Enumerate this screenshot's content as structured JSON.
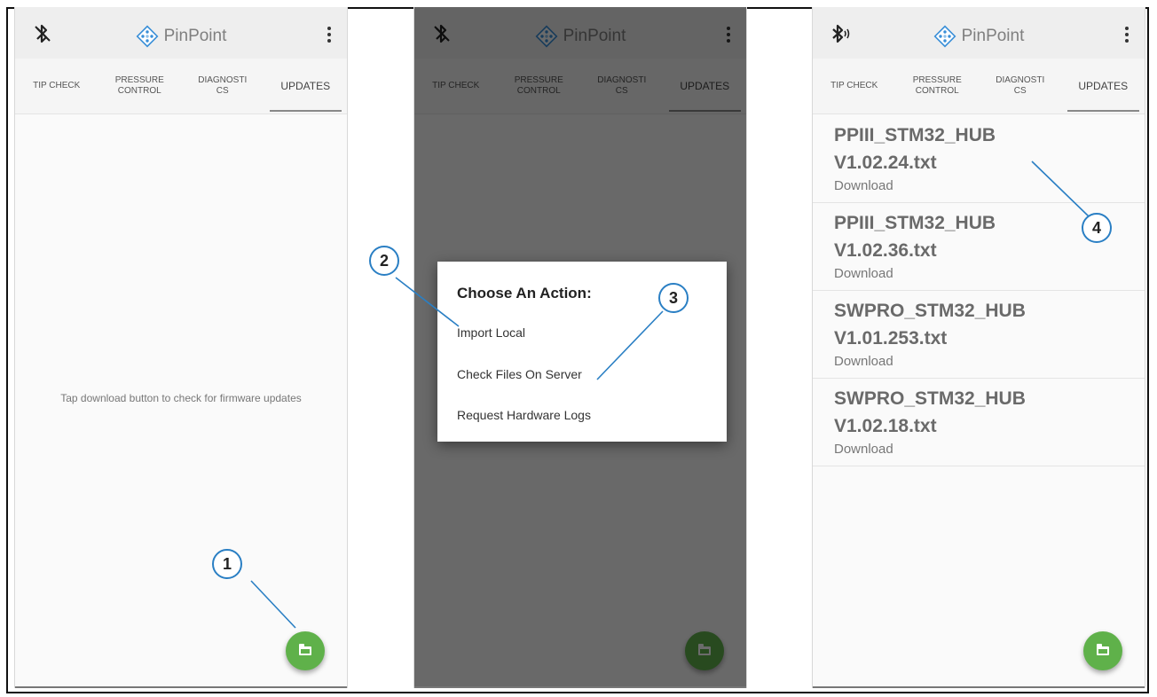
{
  "app": {
    "name": "PinPoint"
  },
  "tabs": [
    {
      "label": "TIP CHECK"
    },
    {
      "label": "PRESSURE\nCONTROL"
    },
    {
      "label": "DIAGNOSTI\nCS"
    },
    {
      "label": "UPDATES",
      "active": true
    }
  ],
  "screen1": {
    "empty_message": "Tap download button to check for firmware updates"
  },
  "screen2": {
    "dialog_title": "Choose An Action:",
    "actions": [
      {
        "label": "Import Local"
      },
      {
        "label": "Check Files On Server"
      },
      {
        "label": "Request Hardware Logs"
      }
    ]
  },
  "screen3": {
    "files": [
      {
        "name": "PPIII_STM32_HUB V1.02.24.txt",
        "action": "Download"
      },
      {
        "name": "PPIII_STM32_HUB V1.02.36.txt",
        "action": "Download"
      },
      {
        "name": "SWPRO_STM32_HUB V1.01.253.txt",
        "action": "Download"
      },
      {
        "name": "SWPRO_STM32_HUB V1.02.18.txt",
        "action": "Download"
      }
    ]
  },
  "callouts": [
    "1",
    "2",
    "3",
    "4"
  ],
  "icons": {
    "bluetooth": "bluetooth-icon",
    "logo": "pinpoint-logo-icon",
    "menu": "kebab-menu-icon",
    "fab": "folder-icon"
  },
  "colors": {
    "fab": "#5fb14a",
    "callout_border": "#2a7fc4",
    "logo_blue": "#3a8fd8"
  }
}
